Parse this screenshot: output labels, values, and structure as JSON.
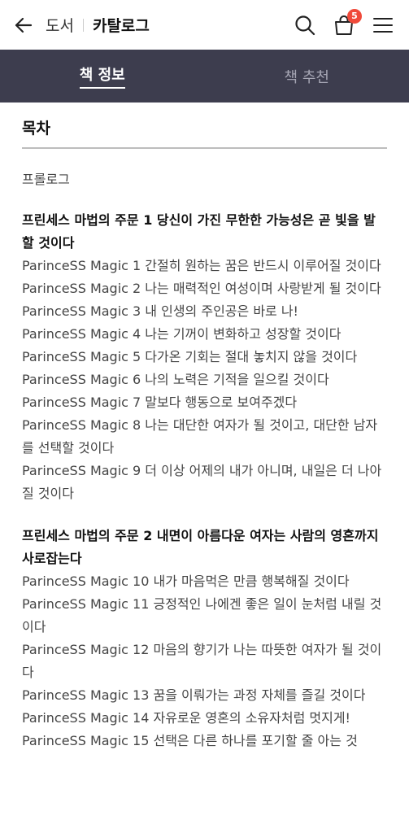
{
  "header": {
    "parent_label": "도서",
    "current_label": "카탈로그",
    "cart_count": "5"
  },
  "tabs": [
    {
      "label": "책 정보",
      "active": true
    },
    {
      "label": "책 추천",
      "active": false
    }
  ],
  "toc": {
    "title": "목차",
    "prologue": "프롤로그",
    "sections": [
      {
        "title": "프린세스 마법의 주문 1 당신이 가진 무한한 가능성은 곧 빛을 발할 것이다",
        "items": [
          "ParinceSS Magic 1 간절히 원하는 꿈은 반드시 이루어질 것이다",
          "ParinceSS Magic 2 나는 매력적인 여성이며 사랑받게 될 것이다",
          "ParinceSS Magic 3 내 인생의 주인공은 바로 나!",
          "ParinceSS Magic 4 나는 기꺼이 변화하고 성장할 것이다",
          "ParinceSS Magic 5 다가온 기회는 절대 놓치지 않을 것이다",
          "ParinceSS Magic 6 나의 노력은 기적을 일으킬 것이다",
          "ParinceSS Magic 7 말보다 행동으로 보여주겠다",
          "ParinceSS Magic 8 나는 대단한 여자가 될 것이고, 대단한 남자를 선택할 것이다",
          "ParinceSS Magic 9 더 이상 어제의 내가 아니며, 내일은 더 나아질 것이다"
        ]
      },
      {
        "title": "프린세스 마법의 주문 2 내면이 아름다운 여자는 사람의 영혼까지 사로잡는다",
        "items": [
          "ParinceSS Magic 10 내가 마음먹은 만큼 행복해질 것이다",
          "ParinceSS Magic 11 긍정적인 나에겐 좋은 일이 눈처럼 내릴 것이다",
          "ParinceSS Magic 12 마음의 향기가 나는 따뜻한 여자가 될 것이다",
          "ParinceSS Magic 13 꿈을 이뤄가는 과정 자체를 즐길 것이다",
          "ParinceSS Magic 14 자유로운 영혼의 소유자처럼 멋지게!",
          "ParinceSS Magic 15 선택은 다른 하나를 포기할 줄 아는 것"
        ]
      }
    ]
  }
}
